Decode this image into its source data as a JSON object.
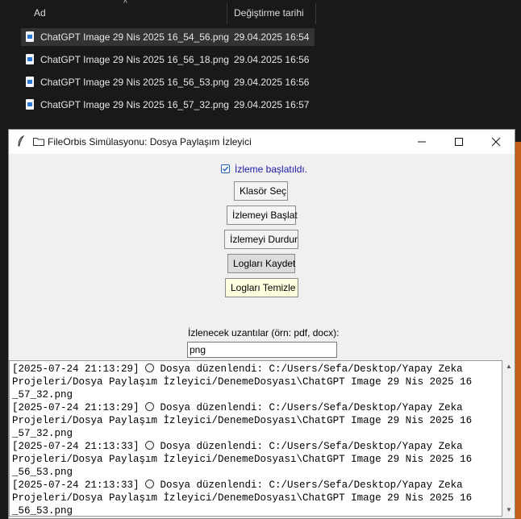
{
  "explorer": {
    "col_name": "Ad",
    "col_date": "Değiştirme tarihi",
    "files": [
      {
        "name": "ChatGPT Image 29 Nis 2025 16_54_56.png",
        "date": "29.04.2025 16:54",
        "selected": true
      },
      {
        "name": "ChatGPT Image 29 Nis 2025 16_56_18.png",
        "date": "29.04.2025 16:56",
        "selected": false
      },
      {
        "name": "ChatGPT Image 29 Nis 2025 16_56_53.png",
        "date": "29.04.2025 16:56",
        "selected": false
      },
      {
        "name": "ChatGPT Image 29 Nis 2025 16_57_32.png",
        "date": "29.04.2025 16:57",
        "selected": false
      }
    ]
  },
  "window": {
    "title": "FileOrbis Simülasyonu: Dosya Paylaşım İzleyici",
    "status": "İzleme başlatıldı.",
    "buttons": {
      "select_folder": "Klasör Seç",
      "start": "İzlemeyi Başlat",
      "stop": "İzlemeyi Durdur",
      "save_logs": "Logları Kaydet",
      "clear_logs": "Logları Temizle"
    },
    "ext_label": "İzlenecek uzantılar (örn: pdf, docx):",
    "ext_value": "png",
    "log_lines": [
      {
        "pre": "[2025-07-24 21:13:29] ",
        "post": " Dosya düzenlendi: C:/Users/Sefa/Desktop/Yapay Zeka"
      },
      {
        "pre": "Projeleri/Dosya Paylaşım İzleyici/DenemeDosyası\\ChatGPT Image 29 Nis 2025 16",
        "post": ""
      },
      {
        "pre": "_57_32.png",
        "post": ""
      },
      {
        "pre": "[2025-07-24 21:13:29] ",
        "post": " Dosya düzenlendi: C:/Users/Sefa/Desktop/Yapay Zeka"
      },
      {
        "pre": "Projeleri/Dosya Paylaşım İzleyici/DenemeDosyası\\ChatGPT Image 29 Nis 2025 16",
        "post": ""
      },
      {
        "pre": "_57_32.png",
        "post": ""
      },
      {
        "pre": "[2025-07-24 21:13:33] ",
        "post": " Dosya düzenlendi: C:/Users/Sefa/Desktop/Yapay Zeka"
      },
      {
        "pre": "Projeleri/Dosya Paylaşım İzleyici/DenemeDosyası\\ChatGPT Image 29 Nis 2025 16",
        "post": ""
      },
      {
        "pre": "_56_53.png",
        "post": ""
      },
      {
        "pre": "[2025-07-24 21:13:33] ",
        "post": " Dosya düzenlendi: C:/Users/Sefa/Desktop/Yapay Zeka"
      },
      {
        "pre": "Projeleri/Dosya Paylaşım İzleyici/DenemeDosyası\\ChatGPT Image 29 Nis 2025 16",
        "post": ""
      },
      {
        "pre": "_56_53.png",
        "post": ""
      }
    ],
    "log_circle_lines": [
      0,
      3,
      6,
      9
    ],
    "accent_color": "#c45f1a",
    "status_color": "#1a1aa6"
  }
}
